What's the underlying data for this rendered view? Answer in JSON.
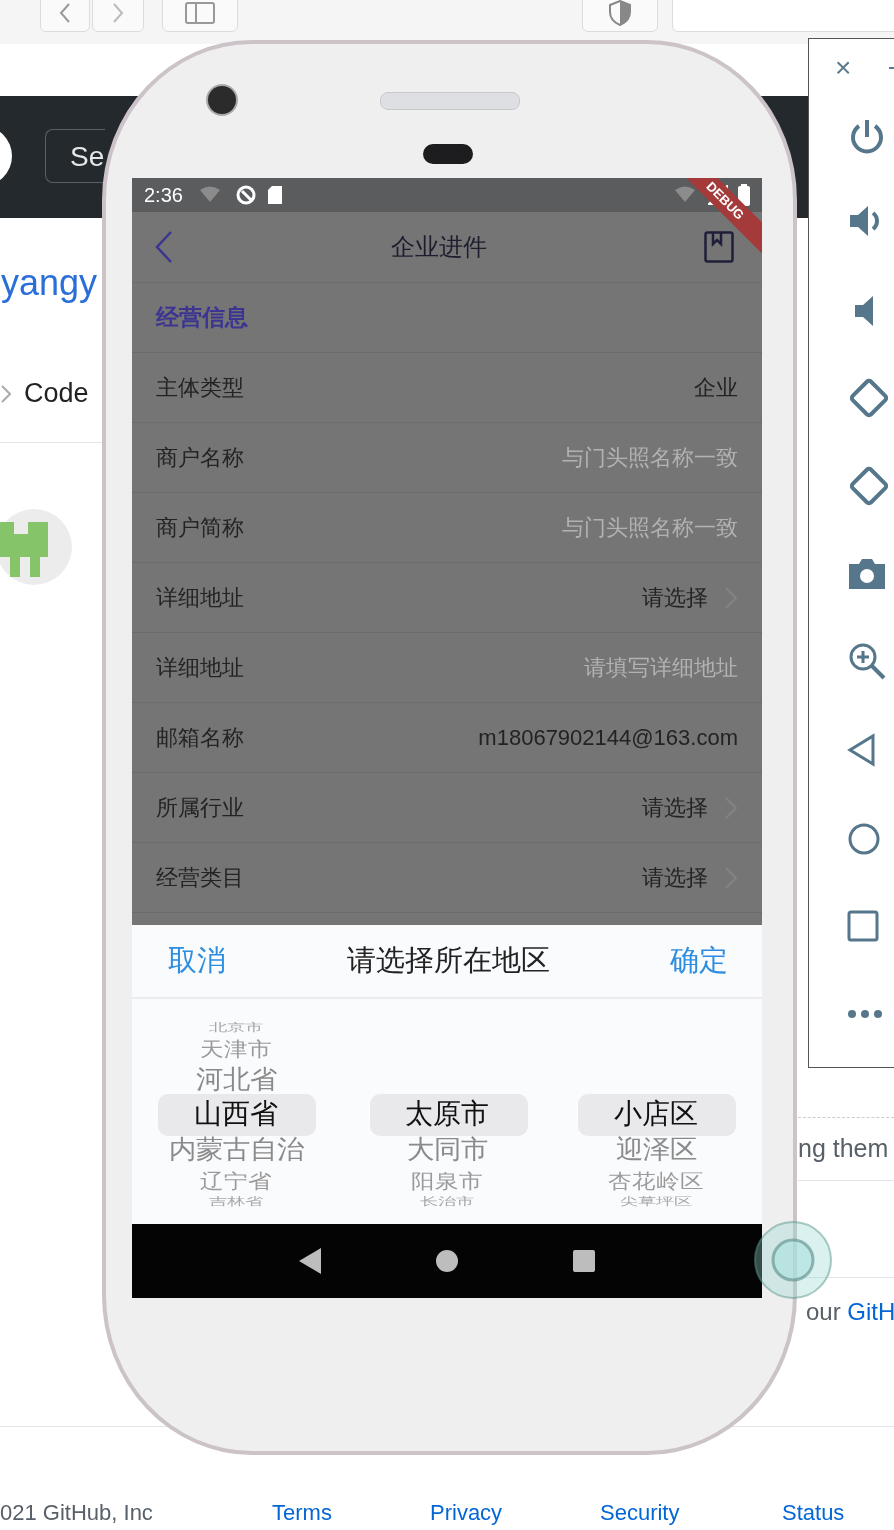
{
  "github_page": {
    "search_button": "Se",
    "repo_owner": "yangy",
    "tab": "Code",
    "snippet": "ng them",
    "note": {
      "text": "our ",
      "link": "GitH"
    },
    "footer": {
      "copyright": "021 GitHub, Inc",
      "links": [
        "Terms",
        "Privacy",
        "Security",
        "Status"
      ]
    }
  },
  "emulator_toolbar": {
    "close": "×"
  },
  "phone": {
    "status_bar": {
      "time": "2:36"
    },
    "debug_banner": "DEBUG",
    "app_bar": {
      "title": "企业进件"
    },
    "section": "经营信息",
    "rows": [
      {
        "label": "主体类型",
        "value": "企业",
        "kind": "text"
      },
      {
        "label": "商户名称",
        "placeholder": "与门头照名称一致",
        "kind": "text"
      },
      {
        "label": "商户简称",
        "placeholder": "与门头照名称一致",
        "kind": "text"
      },
      {
        "label": "详细地址",
        "value": "请选择",
        "kind": "select"
      },
      {
        "label": "详细地址",
        "placeholder": "请填写详细地址",
        "kind": "text"
      },
      {
        "label": "邮箱名称",
        "value": "m18067902144@163.com",
        "kind": "text"
      },
      {
        "label": "所属行业",
        "value": "请选择",
        "kind": "select"
      },
      {
        "label": "经营类目",
        "value": "请选择",
        "kind": "select"
      }
    ],
    "picker": {
      "cancel": "取消",
      "title": "请选择所在地区",
      "confirm": "确定",
      "columns": [
        {
          "items": [
            {
              "text": "北京市",
              "selected": false
            },
            {
              "text": "天津市",
              "selected": false
            },
            {
              "text": "河北省",
              "selected": false
            },
            {
              "text": "山西省",
              "selected": true
            },
            {
              "text": "内蒙古自治",
              "selected": false
            },
            {
              "text": "辽宁省",
              "selected": false
            },
            {
              "text": "吉林省",
              "selected": false
            }
          ]
        },
        {
          "items": [
            {
              "text": "太原市",
              "selected": true
            },
            {
              "text": "大同市",
              "selected": false
            },
            {
              "text": "阳泉市",
              "selected": false
            },
            {
              "text": "长治市",
              "selected": false
            }
          ]
        },
        {
          "items": [
            {
              "text": "小店区",
              "selected": true
            },
            {
              "text": "迎泽区",
              "selected": false
            },
            {
              "text": "杏花岭区",
              "selected": false
            },
            {
              "text": "尖草坪区",
              "selected": false
            }
          ]
        }
      ]
    }
  }
}
